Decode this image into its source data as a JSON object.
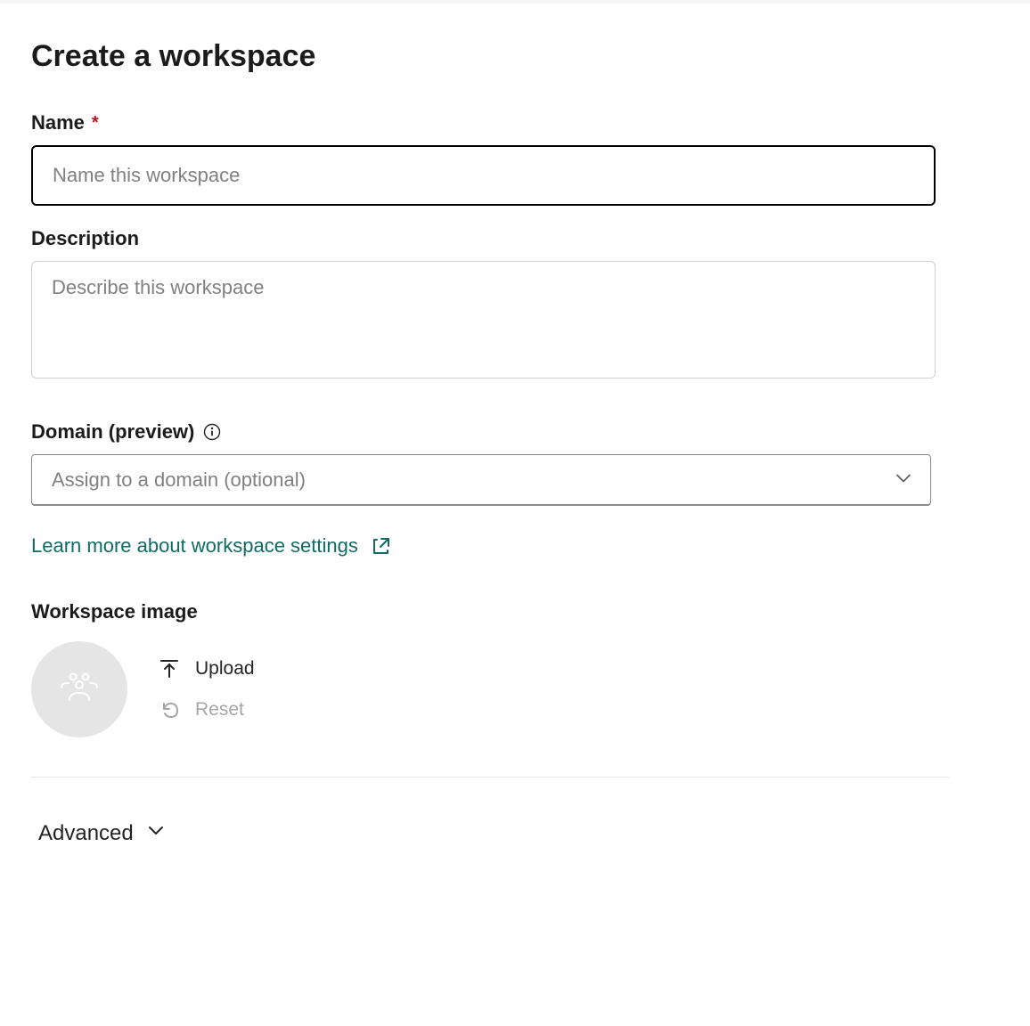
{
  "pageTitle": "Create a workspace",
  "fields": {
    "name": {
      "label": "Name",
      "required": "*",
      "placeholder": "Name this workspace",
      "value": ""
    },
    "description": {
      "label": "Description",
      "placeholder": "Describe this workspace",
      "value": ""
    },
    "domain": {
      "label": "Domain (preview)",
      "placeholder": "Assign to a domain (optional)"
    }
  },
  "learnMore": {
    "text": "Learn more about workspace settings"
  },
  "workspaceImage": {
    "label": "Workspace image",
    "uploadLabel": "Upload",
    "resetLabel": "Reset"
  },
  "advanced": {
    "label": "Advanced"
  }
}
